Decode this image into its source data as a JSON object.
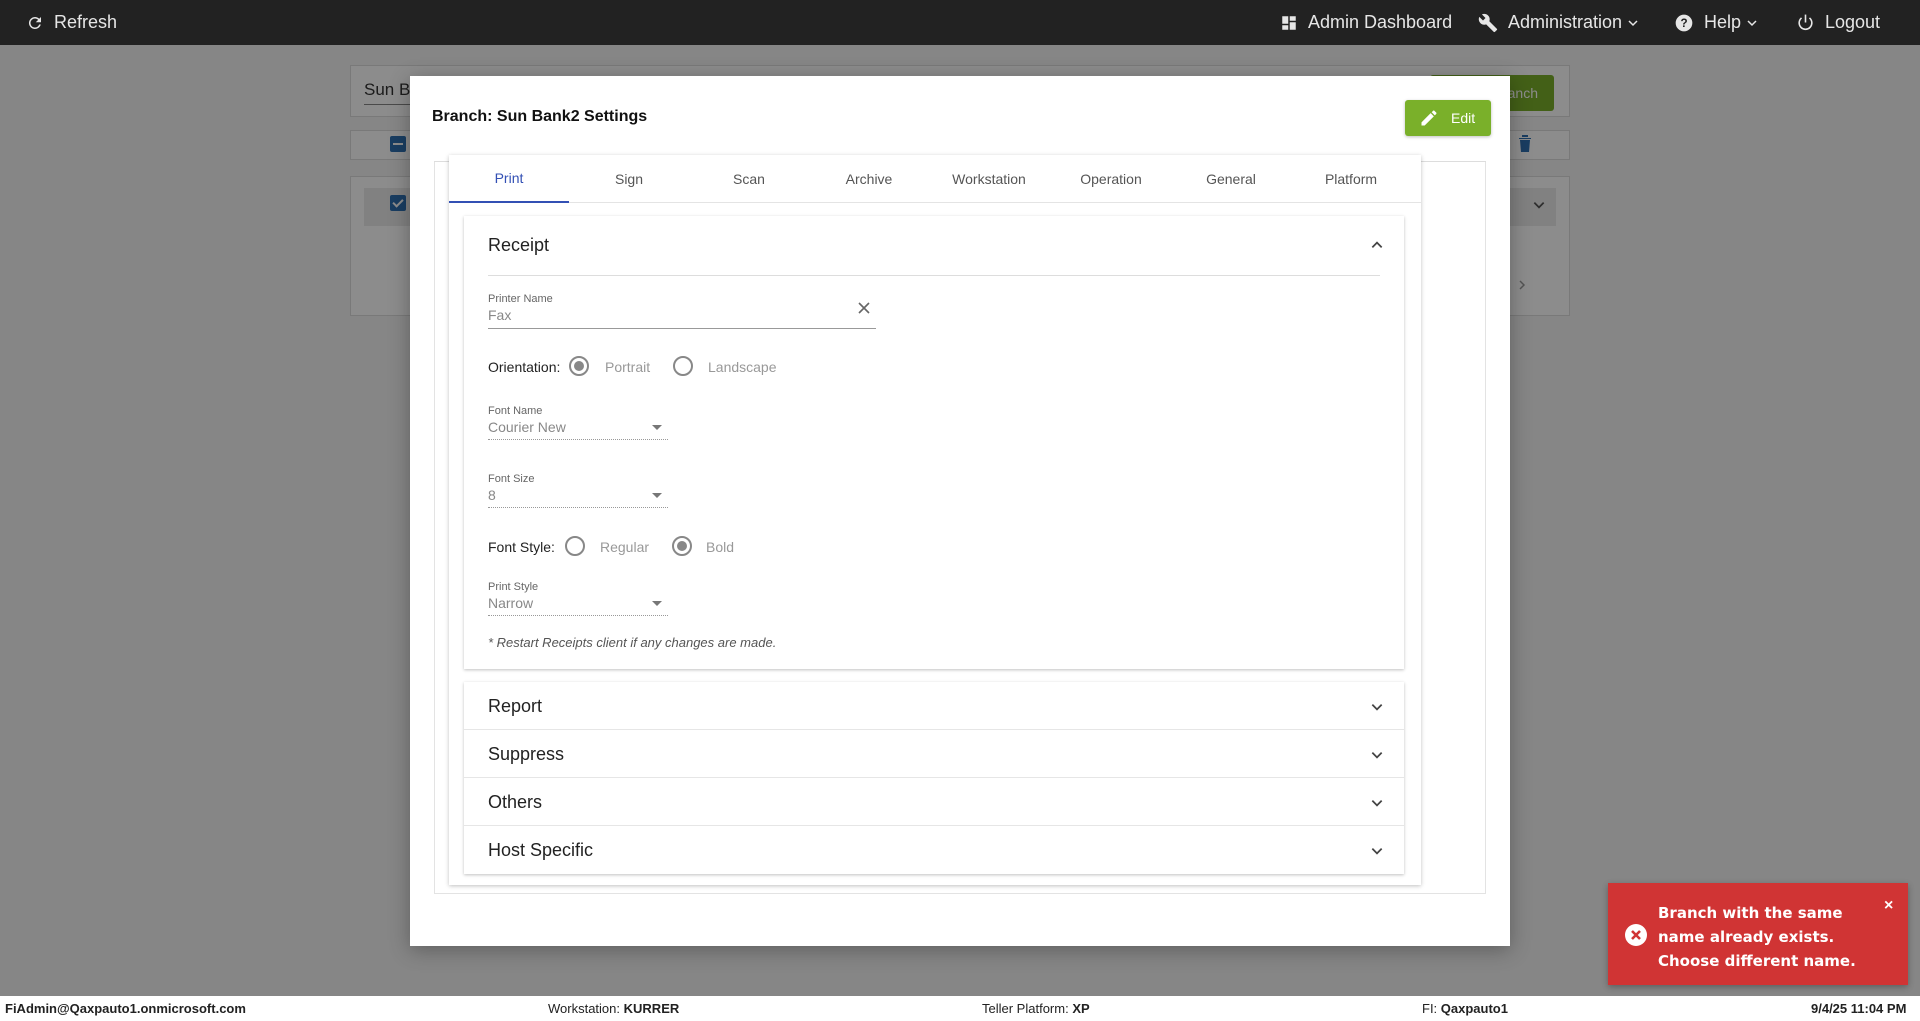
{
  "topbar": {
    "refresh_label": "Refresh",
    "admin_dashboard_label": "Admin Dashboard",
    "administration_label": "Administration",
    "help_label": "Help",
    "logout_label": "Logout"
  },
  "background": {
    "search_value": "Sun B",
    "add_button_label": "anch"
  },
  "modal": {
    "title": "Branch: Sun Bank2 Settings",
    "edit_label": "Edit",
    "tabs": [
      {
        "label": "Print",
        "active": true
      },
      {
        "label": "Sign"
      },
      {
        "label": "Scan"
      },
      {
        "label": "Archive"
      },
      {
        "label": "Workstation"
      },
      {
        "label": "Operation"
      },
      {
        "label": "General"
      },
      {
        "label": "Platform"
      }
    ],
    "receipt": {
      "title": "Receipt",
      "printer_name_label": "Printer Name",
      "printer_name_value": "Fax",
      "orientation_label": "Orientation:",
      "orientation_options": [
        "Portrait",
        "Landscape"
      ],
      "orientation_selected": "Portrait",
      "font_name_label": "Font Name",
      "font_name_value": "Courier New",
      "font_size_label": "Font Size",
      "font_size_value": "8",
      "font_style_label": "Font Style:",
      "font_style_options": [
        "Regular",
        "Bold"
      ],
      "font_style_selected": "Bold",
      "print_style_label": "Print Style",
      "print_style_value": "Narrow",
      "note": "* Restart Receipts client if any changes are made."
    },
    "sections": [
      "Report",
      "Suppress",
      "Others",
      "Host Specific"
    ]
  },
  "toast": {
    "message": "Branch with the same name already exists. Choose different name.",
    "close_label": "×"
  },
  "footer": {
    "user": "FiAdmin@Qaxpauto1.onmicrosoft.com",
    "workstation_label": "Workstation:",
    "workstation_value": "KURRER",
    "platform_label": "Teller Platform:",
    "platform_value": "XP",
    "fi_label": "FI:",
    "fi_value": "Qaxpauto1",
    "datetime": "9/4/25 11:04 PM"
  },
  "colors": {
    "topbar_bg": "#222222",
    "accent_green": "#7ab02a",
    "tab_active": "#3350b4",
    "toast_red": "#d03434",
    "checkbox_blue": "#2f6fb1"
  }
}
